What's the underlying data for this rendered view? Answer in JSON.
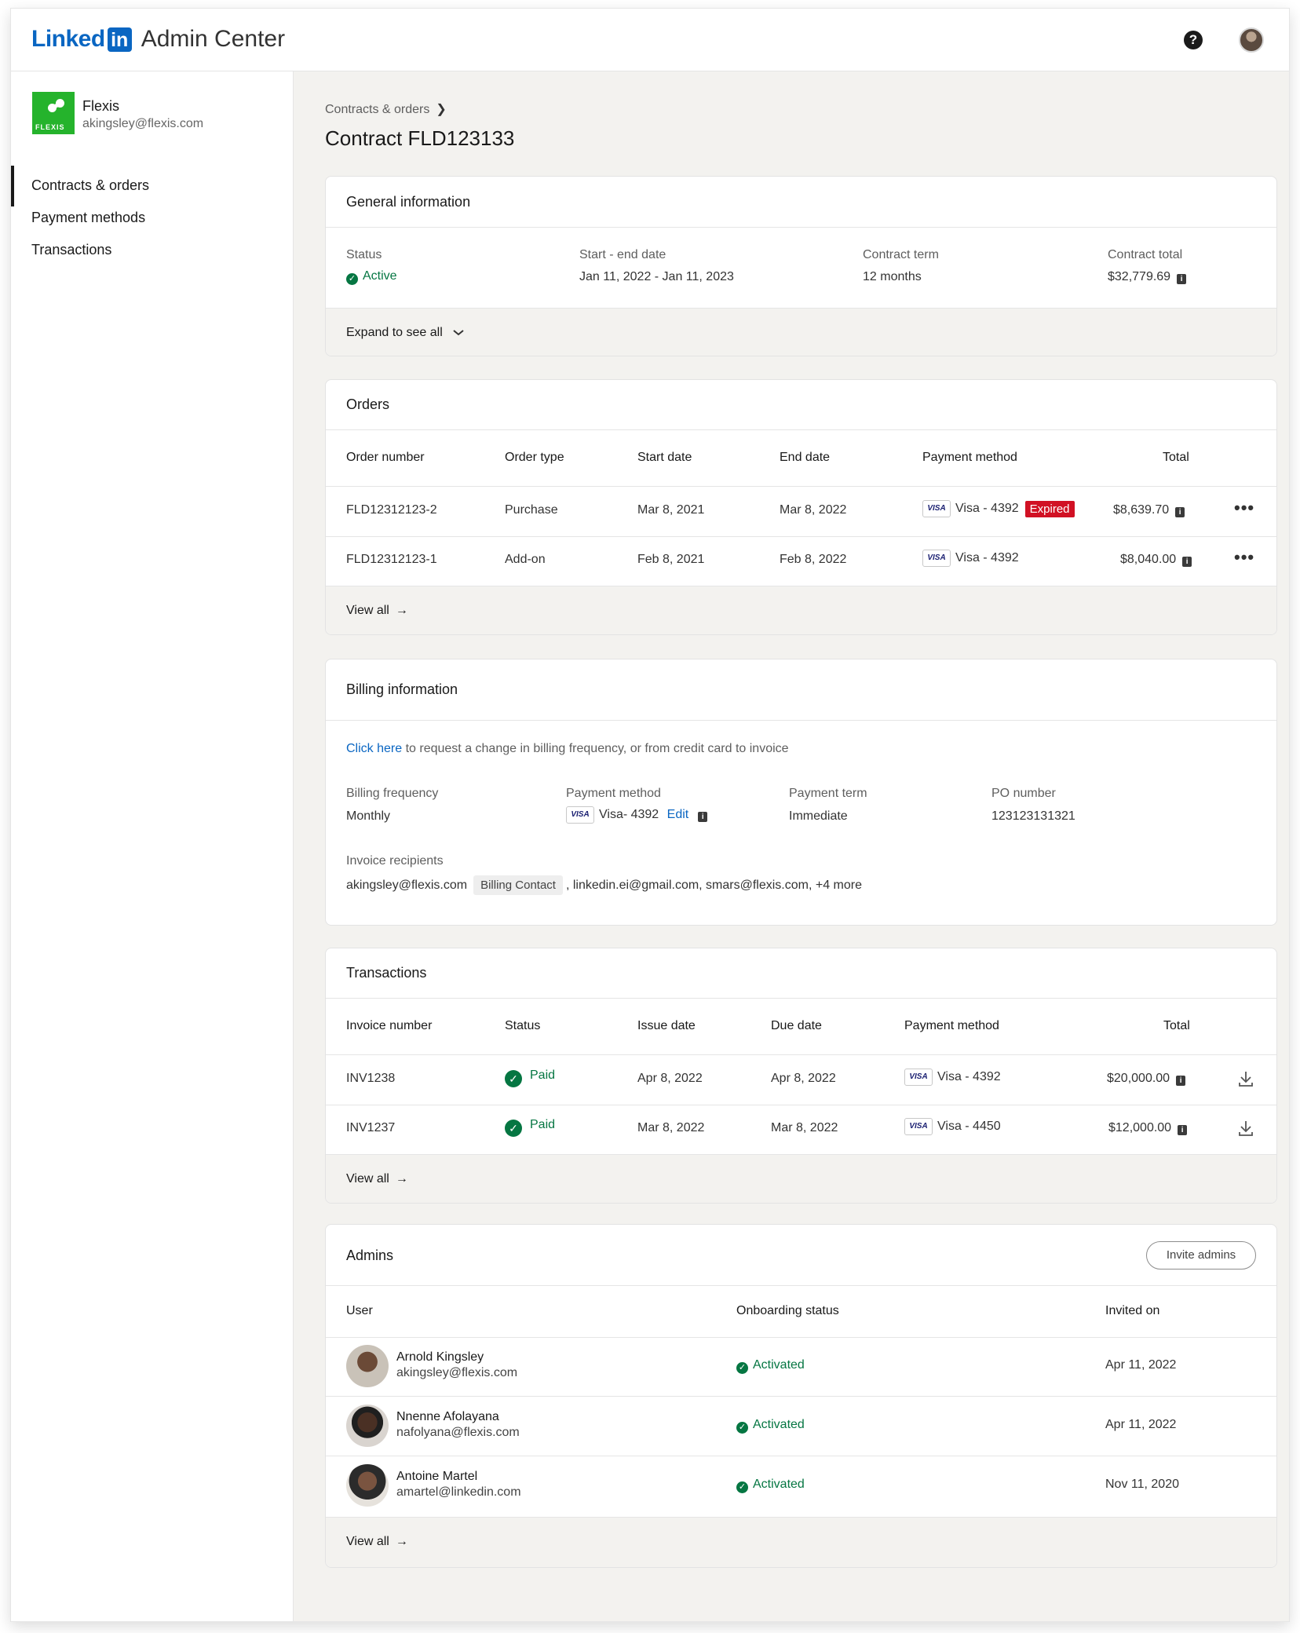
{
  "header": {
    "brand_linked": "Linked",
    "brand_in": "in",
    "app_title": "Admin Center",
    "help_glyph": "?"
  },
  "org": {
    "name": "Flexis",
    "email": "akingsley@flexis.com",
    "logo_word": "FLEXIS"
  },
  "nav": {
    "items": [
      "Contracts & orders",
      "Payment methods",
      "Transactions"
    ],
    "active": "Contracts & orders"
  },
  "breadcrumb": {
    "label": "Contracts & orders",
    "chevron": "❯"
  },
  "page_title": "Contract FLD123133",
  "general": {
    "title": "General information",
    "status_label": "Status",
    "status_value": "Active",
    "dates_label": "Start - end date",
    "dates_value": "Jan 11, 2022 - Jan 11, 2023",
    "term_label": "Contract term",
    "term_value": "12 months",
    "total_label": "Contract total",
    "total_value": "$32,779.69",
    "expand_label": "Expand to see all",
    "expand_icon": "chevron-down"
  },
  "orders": {
    "title": "Orders",
    "headers": [
      "Order number",
      "Order type",
      "Start date",
      "End date",
      "Payment method",
      "Total"
    ],
    "rows": [
      {
        "number": "FLD12312123-2",
        "type": "Purchase",
        "start": "Mar 8, 2021",
        "end": "Mar 8, 2022",
        "card": "VISA",
        "method": "Visa - 4392",
        "badge": "Expired",
        "total": "$8,639.70",
        "more": "•••"
      },
      {
        "number": "FLD12312123-1",
        "type": "Add-on",
        "start": "Feb 8, 2021",
        "end": "Feb 8, 2022",
        "card": "VISA",
        "method": "Visa - 4392",
        "badge": "",
        "total": "$8,040.00",
        "more": "•••"
      }
    ],
    "view_all": "View all"
  },
  "billing": {
    "title": "Billing information",
    "click_here": "Click here",
    "request_text": " to request a change in billing frequency, or from credit card to invoice",
    "frequency_label": "Billing frequency",
    "frequency_value": "Monthly",
    "method_label": "Payment method",
    "method_card": "VISA",
    "method_value": "Visa- 4392",
    "edit_label": "Edit",
    "term_label": "Payment term",
    "term_value": "Immediate",
    "po_label": "PO number",
    "po_value": "123123131321",
    "recipients_label": "Invoice recipients",
    "recipient_primary": "akingsley@flexis.com",
    "recipient_chip": "Billing Contact",
    "recipients_rest": ", linkedin.ei@gmail.com, smars@flexis.com, +4 more"
  },
  "transactions": {
    "title": "Transactions",
    "headers": [
      "Invoice number",
      "Status",
      "Issue date",
      "Due date",
      "Payment method",
      "Total"
    ],
    "rows": [
      {
        "invoice": "INV1238",
        "status": "Paid",
        "issue": "Apr 8, 2022",
        "due": "Apr 8, 2022",
        "card": "VISA",
        "method": "Visa - 4392",
        "total": "$20,000.00"
      },
      {
        "invoice": "INV1237",
        "status": "Paid",
        "issue": "Mar 8, 2022",
        "due": "Mar 8, 2022",
        "card": "VISA",
        "method": "Visa - 4450",
        "total": "$12,000.00"
      }
    ],
    "view_all": "View all"
  },
  "admins": {
    "title": "Admins",
    "invite_label": "Invite admins",
    "headers": [
      "User",
      "Onboarding status",
      "Invited on"
    ],
    "rows": [
      {
        "name": "Arnold Kingsley",
        "email": "akingsley@flexis.com",
        "status": "Activated",
        "invited": "Apr 11, 2022"
      },
      {
        "name": "Nnenne Afolayana",
        "email": "nafolyana@flexis.com",
        "status": "Activated",
        "invited": "Apr 11, 2022"
      },
      {
        "name": "Antoine Martel",
        "email": "amartel@linkedin.com",
        "status": "Activated",
        "invited": "Nov 11, 2020"
      }
    ],
    "view_all": "View all"
  },
  "colors": {
    "brand_blue": "#0a66c2",
    "success_green": "#057642",
    "expired_red": "#d11124",
    "page_bg": "#f3f2ef"
  },
  "icons": {
    "help": "help-icon",
    "arrow": "→",
    "check": "✓",
    "info": "i"
  }
}
